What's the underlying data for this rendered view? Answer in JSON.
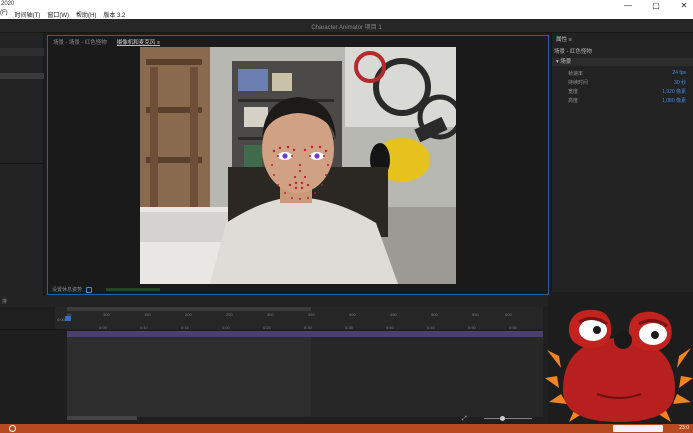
{
  "titlebar": {
    "app_fragment": "2020",
    "menu": [
      "(F)",
      "时间轴(T)",
      "窗口(W)",
      "帮助(H)",
      "版本 3.2"
    ],
    "window_controls": [
      "—",
      "▢",
      "✕"
    ]
  },
  "app_header": {
    "project_title": "Character Animator 项目 1"
  },
  "scene_panel": {
    "tabs": [
      {
        "label": "场景 - 场景 - 红色怪物",
        "active": false
      },
      {
        "label": "摄像机和麦克风 ≡",
        "active": true
      }
    ],
    "status_label": "设置休息姿势"
  },
  "properties": {
    "tab_label": "属性 ≡",
    "title": "场景 - 红色怪物",
    "section_label": "▾ 场景",
    "rows": [
      {
        "label": "帧速率",
        "value": "24 fps"
      },
      {
        "label": "持续时间",
        "value": "30 秒"
      },
      {
        "label": "宽度",
        "value": "1,920 像素"
      },
      {
        "label": "高度",
        "value": "1,080 像素"
      }
    ]
  },
  "timeline": {
    "header_label": "排",
    "ruler_ticks": [
      "0:00",
      "0:05",
      "0:10",
      "0:15",
      "0:20",
      "0:25",
      "0:30",
      "0:35",
      "0:40",
      "0:45",
      "0:50",
      "0:55"
    ],
    "ruler_frames": [
      "00",
      "100",
      "150",
      "200",
      "250",
      "300",
      "350",
      "400",
      "450",
      "500",
      "550",
      "600",
      "650"
    ]
  },
  "taskbar": {
    "clock": "23:0"
  },
  "colors": {
    "accent": "#2b5f9e",
    "value_blue": "#3d8ee6",
    "taskbar": "#b84a22",
    "track_purple": "#4b3f6e",
    "puppet_red": "#b81f1f",
    "puppet_spikes": "#f2851f"
  }
}
